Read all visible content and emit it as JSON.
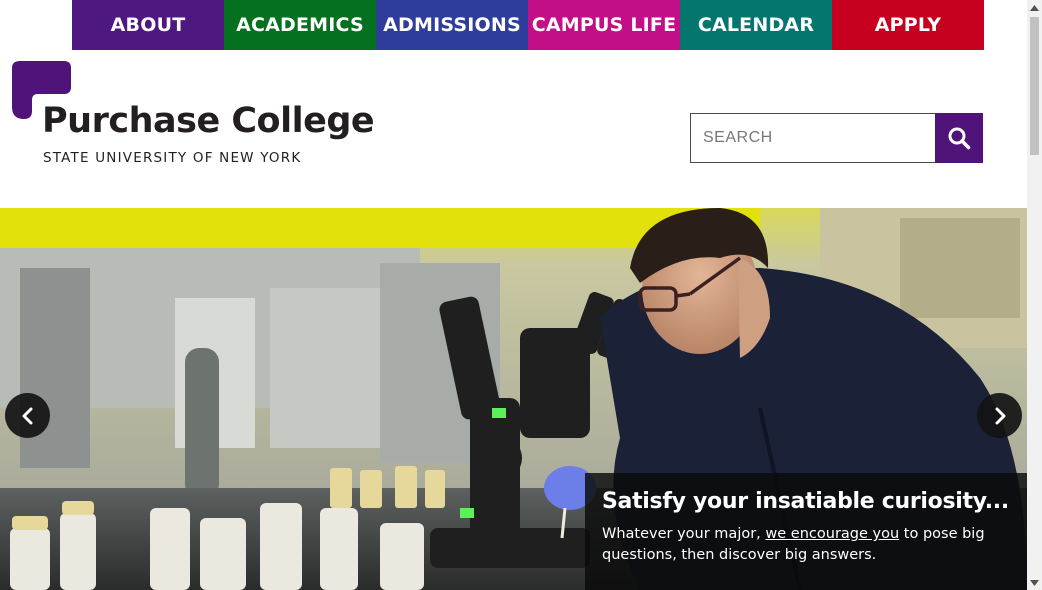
{
  "nav": {
    "items": [
      {
        "label": "ABOUT",
        "color": "#4f1780"
      },
      {
        "label": "ACADEMICS",
        "color": "#067021"
      },
      {
        "label": "ADMISSIONS",
        "color": "#2f3d9a"
      },
      {
        "label": "CAMPUS LIFE",
        "color": "#c20e87"
      },
      {
        "label": "CALENDAR",
        "color": "#03776d"
      },
      {
        "label": "APPLY",
        "color": "#c8001f"
      }
    ]
  },
  "logo": {
    "name": "Purchase College",
    "subtitle": "STATE UNIVERSITY OF NEW YORK",
    "mark_color": "#50137a"
  },
  "search": {
    "placeholder": "SEARCH",
    "button_icon": "search-icon"
  },
  "hero": {
    "headline": "Satisfy your insatiable curiosity...",
    "body_before": "Whatever your major, ",
    "body_link": "we encourage you",
    "body_after": " to pose big questions, then discover big answers.",
    "prev_icon": "chevron-left-icon",
    "next_icon": "chevron-right-icon"
  },
  "colors": {
    "accent": "#50137a"
  }
}
